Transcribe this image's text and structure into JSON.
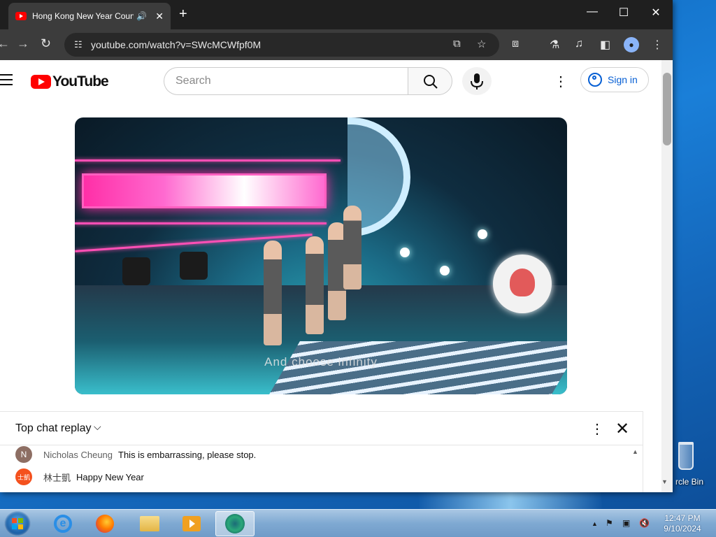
{
  "browser": {
    "tab": {
      "title": "Hong Kong New Year Coun",
      "audio_icon": "🔊",
      "close_icon": "✕"
    },
    "newtab_icon": "+",
    "window_controls": {
      "minimize": "—",
      "maximize": "☐",
      "close": "✕"
    },
    "toolbar": {
      "back": "←",
      "forward": "→",
      "reload": "↻",
      "site_info_icon": "☷",
      "url": "youtube.com/watch?v=SWcMCWfpf0M",
      "install_icon": "⧉",
      "bookmark_icon": "☆",
      "extensions_icon": "⧈",
      "labs_icon": "⚗",
      "media_icon": "♫",
      "sidepanel_icon": "◧",
      "profile_icon": "●",
      "menu_icon": "⋮"
    }
  },
  "youtube": {
    "logo_text": "YouTube",
    "search_placeholder": "Search",
    "search_icon": "⌕",
    "mic_icon": "🎤",
    "more_icon": "⋮",
    "signin_label": "Sign in",
    "video": {
      "caption": "And choose infinity"
    },
    "chat": {
      "title": "Top chat replay",
      "chevron": "⌵",
      "more_icon": "⋮",
      "close_icon": "✕",
      "scroll_up": "▲",
      "scroll_down": "▼",
      "messages": [
        {
          "avatar": "N",
          "avatar_color": "#8d6e63",
          "author": "Nicholas Cheung",
          "text": "This is embarrassing, please stop."
        },
        {
          "avatar": "士凱",
          "avatar_color": "#f4511e",
          "author": "林士凱",
          "text": "Happy New Year"
        }
      ]
    }
  },
  "desktop": {
    "recycle_bin_label": "rcle Bin"
  },
  "taskbar": {
    "apps": [
      {
        "name": "internet-explorer",
        "label": "e"
      },
      {
        "name": "firefox",
        "label": ""
      },
      {
        "name": "file-explorer",
        "label": ""
      },
      {
        "name": "media-player",
        "label": ""
      },
      {
        "name": "chrome",
        "label": ""
      }
    ],
    "tray": {
      "show_hidden": "▲",
      "flag": "⚑",
      "network": "▣",
      "volume_muted": "🔇"
    },
    "time": "12:47 PM",
    "date": "9/10/2024"
  }
}
